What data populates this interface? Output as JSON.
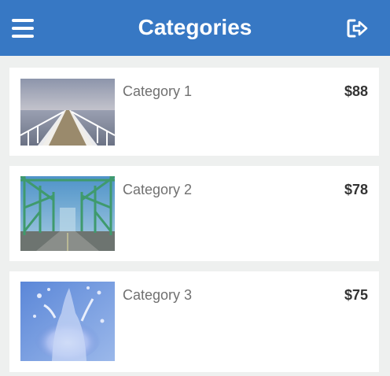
{
  "header": {
    "title": "Categories",
    "menu_icon": "hamburger-menu-icon",
    "logout_icon": "logout-icon",
    "background_color": "#3778c4"
  },
  "categories": [
    {
      "name": "Category 1",
      "price": "$88",
      "image": "pier-photo"
    },
    {
      "name": "Category 2",
      "price": "$78",
      "image": "bridge-photo"
    },
    {
      "name": "Category 3",
      "price": "$75",
      "image": "water-splash-photo"
    }
  ]
}
